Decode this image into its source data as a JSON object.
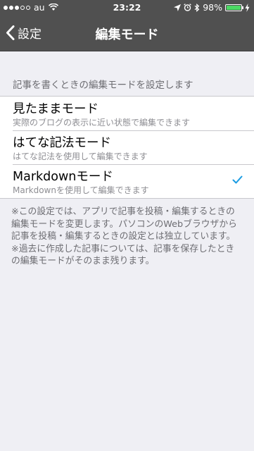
{
  "status_bar": {
    "carrier": "au",
    "time": "23:22",
    "battery_percent": "98%",
    "battery_level": 0.98,
    "signal_bars": 3,
    "signal_total": 5
  },
  "nav": {
    "back_label": "設定",
    "title": "編集モード"
  },
  "section_header": "記事を書くときの編集モードを設定します",
  "options": [
    {
      "title": "見たままモード",
      "subtitle": "実際のブログの表示に近い状態で編集できます",
      "selected": false
    },
    {
      "title": "はてな記法モード",
      "subtitle": "はてな記法を使用して編集できます",
      "selected": false
    },
    {
      "title": "Markdownモード",
      "subtitle": "Markdownを使用して編集できます",
      "selected": true
    }
  ],
  "footer": {
    "note1": "※この設定では、アプリで記事を投稿・編集するときの編集モードを変更します。パソコンのWebブラウザから記事を投稿・編集するときの設定とは独立しています。",
    "note2": "※過去に作成した記事については、記事を保存したときの編集モードがそのまま残ります。"
  },
  "colors": {
    "nav_background": "#505050",
    "tint": "#1a9ce3",
    "battery_fill": "#4cd964"
  }
}
